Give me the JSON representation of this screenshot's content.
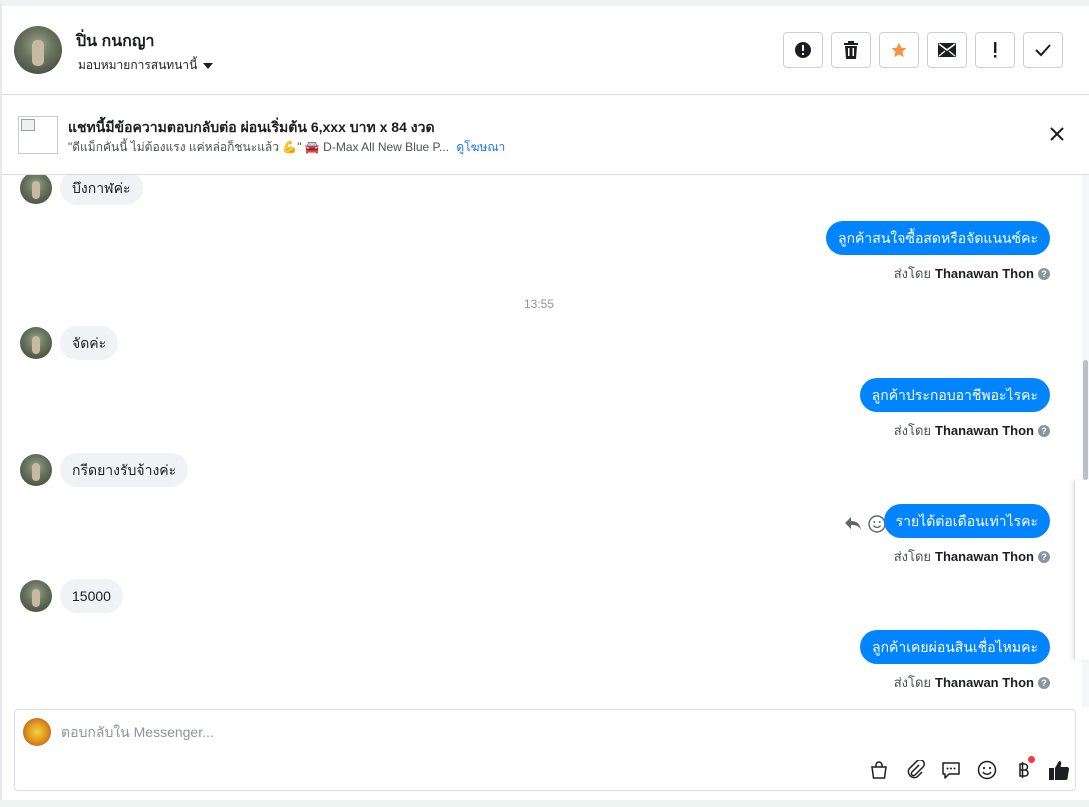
{
  "header": {
    "contact_name": "ปิ่น กนกญา",
    "assign_label": "มอบหมายการสนทนานี้"
  },
  "actions": [
    {
      "name": "mark-spam-button",
      "icon": "alert-circle-icon"
    },
    {
      "name": "delete-button",
      "icon": "trash-icon"
    },
    {
      "name": "star-button",
      "icon": "star-icon",
      "color": "#f7923b"
    },
    {
      "name": "mark-unread-button",
      "icon": "envelope-icon"
    },
    {
      "name": "follow-up-button",
      "icon": "exclamation-icon"
    },
    {
      "name": "mark-done-button",
      "icon": "check-icon"
    }
  ],
  "ad": {
    "title": "แชทนี้มีข้อความตอบกลับต่อ ผ่อนเริ่มต้น 6,xxx บาท x 84 งวด",
    "subtitle": "\"ดีแม็กคันนี้ ไม่ต้องแรง แค่หล่อก็ชนะแล้ว 💪\" 🚘 D-Max All New Blue P...",
    "link": "ดูโฆษณา"
  },
  "messages": {
    "m1": "บึงกาฬค่ะ",
    "m2": "ลูกค้าสนใจซื้อสดหรือจัดแนนซ์คะ",
    "time1": "13:55",
    "m3": "จัดค่ะ",
    "m4": "ลูกค้าประกอบอาชีพอะไรคะ",
    "m5": "กรีดยางรับจ้างค่ะ",
    "m6": "รายได้ต่อเดือนเท่าไรคะ",
    "m7": "15000",
    "m8": "ลูกค้าเคยผ่อนสินเชื่อไหมคะ",
    "sent_by_prefix": "ส่งโดย",
    "sender": "Thanawan Thon"
  },
  "composer": {
    "placeholder": "ตอบกลับใน Messenger..."
  },
  "colors": {
    "outgoing": "#0084ff",
    "incoming": "#f0f2f5",
    "link": "#1877f2"
  }
}
